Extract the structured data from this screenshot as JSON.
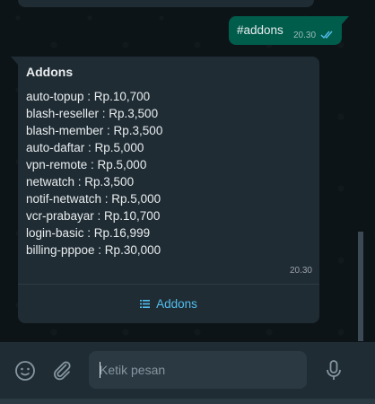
{
  "outgoing": {
    "text": "#addons",
    "time": "20.30",
    "status": "read-double-check-icon"
  },
  "incoming": {
    "title": "Addons",
    "lines": [
      "auto-topup : Rp.10,700",
      "blash-reseller : Rp.3,500",
      "blash-member : Rp.3,500",
      "auto-daftar : Rp.5,000",
      "vpn-remote : Rp.5,000",
      "netwatch : Rp.3,500",
      "notif-netwatch : Rp.5,000",
      "vcr-prabayar : Rp.10,700",
      "login-basic : Rp.16,999",
      "billing-pppoe : Rp.30,000"
    ],
    "time": "20.30",
    "action_icon": "list-icon",
    "action_label": "Addons"
  },
  "composer": {
    "placeholder": "Ketik pesan",
    "icons": [
      "emoji-icon",
      "paperclip-icon",
      "microphone-icon"
    ]
  },
  "colors": {
    "chat_bg": "#0d1418",
    "incoming_bubble": "#1f2c34",
    "outgoing_bubble": "#005c4b",
    "link_blue": "#53bdeb",
    "text_primary": "#e9edef"
  }
}
